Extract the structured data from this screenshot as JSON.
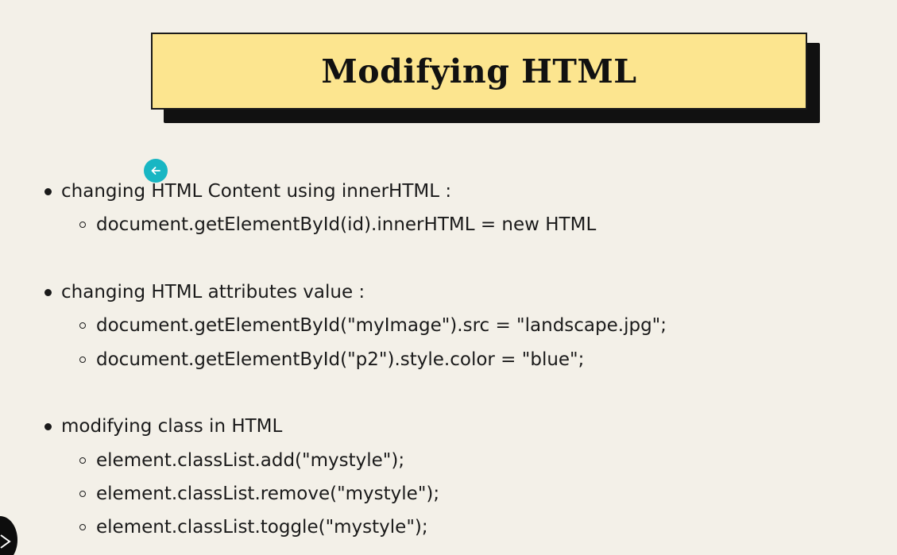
{
  "title": "Modifying HTML",
  "sections": [
    {
      "heading": "changing HTML Content using innerHTML :",
      "items": [
        "document.getElementById(id).innerHTML = new HTML"
      ]
    },
    {
      "heading": "changing HTML attributes value :",
      "items": [
        "document.getElementById(\"myImage\").src = \"landscape.jpg\";",
        "document.getElementById(\"p2\").style.color = \"blue\";"
      ]
    },
    {
      "heading": "modifying class in HTML",
      "items": [
        "element.classList.add(\"mystyle\");",
        "element.classList.remove(\"mystyle\");",
        "element.classList.toggle(\"mystyle\");"
      ]
    }
  ],
  "colors": {
    "background": "#f3f0e8",
    "title_fill": "#fce58f",
    "title_shadow": "#111111",
    "cursor": "#18b6c3"
  },
  "icons": {
    "cursor": "arrow-left-icon",
    "corner": "play-badge-icon"
  }
}
